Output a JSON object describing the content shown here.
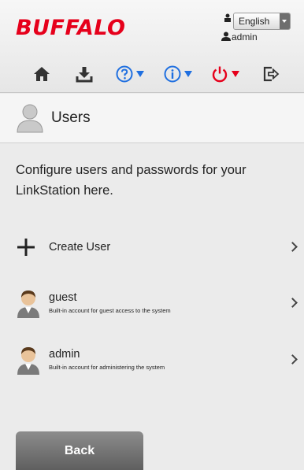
{
  "header": {
    "brand": "BUFFALO",
    "language": "English",
    "username": "admin"
  },
  "toolbar": {
    "icons": [
      "home-icon",
      "download-icon",
      "help-icon",
      "info-icon",
      "power-icon",
      "logout-icon"
    ],
    "colors": {
      "help": "#1f6fe0",
      "info": "#1f6fe0",
      "power": "#e6001b",
      "dark": "#333333"
    }
  },
  "page": {
    "title": "Users",
    "description": "Configure users and passwords for your LinkStation here."
  },
  "list": {
    "create_label": "Create User",
    "users": [
      {
        "name": "guest",
        "desc": "Built-in account for guest access to the system"
      },
      {
        "name": "admin",
        "desc": "Built-in account for administering the system"
      }
    ]
  },
  "footer": {
    "back_label": "Back"
  }
}
